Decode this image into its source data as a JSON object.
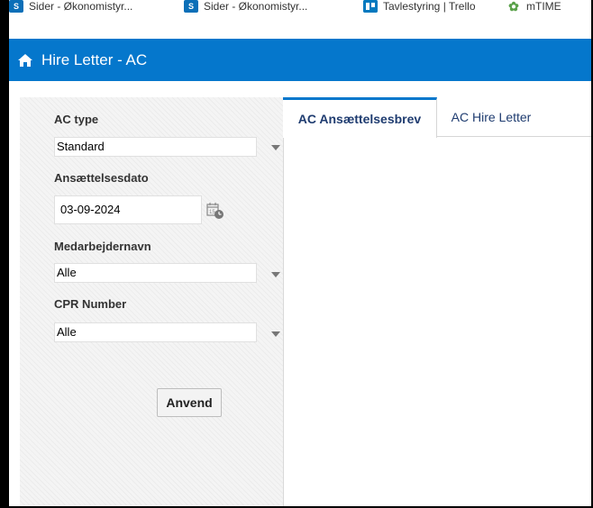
{
  "bookmarks": [
    {
      "icon": "sharepoint-icon",
      "label": "Sider - Økonomistyr..."
    },
    {
      "icon": "sharepoint-icon",
      "label": "Sider - Økonomistyr..."
    },
    {
      "icon": "trello-icon",
      "label": "Tavlestyring | Trello"
    },
    {
      "icon": "mtime-icon",
      "label": "mTIME"
    }
  ],
  "header": {
    "title": "Hire Letter - AC"
  },
  "filters": {
    "ac_type": {
      "label": "AC type",
      "value": "Standard"
    },
    "date": {
      "label": "Ansættelsesdato",
      "value": "03-09-2024"
    },
    "employee": {
      "label": "Medarbejdernavn",
      "value": "Alle"
    },
    "cpr": {
      "label": "CPR Number",
      "value": "Alle"
    },
    "apply_label": "Anvend"
  },
  "tabs": [
    {
      "label": "AC Ansættelsesbrev",
      "active": true
    },
    {
      "label": "AC Hire Letter",
      "active": false
    }
  ],
  "colors": {
    "header_bg": "#0577cc",
    "tab_text": "#1f3c70"
  }
}
